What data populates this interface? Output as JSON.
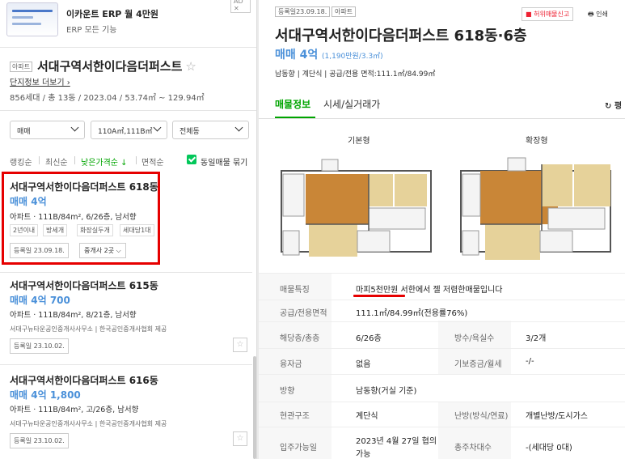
{
  "ad": {
    "title": "이카운트 ERP 월 4만원",
    "subtitle": "ERP 모든 기능",
    "badge": "AD ✕"
  },
  "complex": {
    "tag": "아파트",
    "name": "서대구역서한이다음더퍼스트",
    "link": "단지정보 더보기 ›",
    "info": "856세대 / 총 13동 / 2023.04 / 53.74㎡ ~ 129.94㎡"
  },
  "filters": [
    {
      "label": "매매"
    },
    {
      "label": "110A㎡,111B㎡"
    },
    {
      "label": "전체동"
    }
  ],
  "sort": {
    "items": [
      "랭킹순",
      "최신순",
      "낮은가격순 ↓",
      "면적순"
    ],
    "same_listing": "동일매물 묶기"
  },
  "listings": [
    {
      "title": "서대구역서한이다음더퍼스트 618동",
      "price": "매매 4억",
      "spec": "아파트 · 111B/84m², 6/26층, 남서향",
      "tags": [
        "2년이내",
        "방세개",
        "화장실두개",
        "세대당1대"
      ],
      "date": "등록일 23.09.18.",
      "agents": "중개사 2곳 ⌵"
    },
    {
      "title": "서대구역서한이다음더퍼스트 615동",
      "price": "매매 4억 700",
      "spec": "아파트 · 111B/84m², 8/21층, 남서향",
      "source": "서대구뉴타운공인중개사사무소 | 한국공인중개사협회 제공",
      "date": "등록일 23.10.02."
    },
    {
      "title": "서대구역서한이다음더퍼스트 616동",
      "price": "매매 4억 1,800",
      "spec": "아파트 · 111B/84m², 고/26층, 남서향",
      "source": "서대구뉴타운공인중개사사무소 | 한국공인중개사협회 제공",
      "date": "등록일 23.10.02."
    }
  ],
  "detail": {
    "date_tag": "등록일23.09.18.",
    "type_tag": "아파트",
    "report": "■ 허위매물신고",
    "print": "🖶 인쇄",
    "title": "서대구역서한이다음더퍼스트 618동·6층",
    "price": "매매 4억",
    "price_per": "(1,190만원/3.3㎡)",
    "meta": "남동향 | 계단식 | 공급/전용 면적:111.1㎡/84.99㎡",
    "tabs": [
      "매물정보",
      "시세/실거래가"
    ],
    "refresh": "↻ 평",
    "plan_labels": [
      "기본형",
      "확장형"
    ],
    "rows": [
      {
        "label": "매물특징",
        "value": "마피5천만원 서한에서 젤 저렴한매물입니다"
      },
      {
        "label": "공급/전용면적",
        "value": "111.1㎡/84.99㎡(전용률76%)"
      },
      {
        "label": "해당층/총층",
        "value": "6/26층",
        "label2": "방수/욕실수",
        "value2": "3/2개"
      },
      {
        "label": "융자금",
        "value": "없음",
        "label2": "기보증금/월세",
        "value2": "-/-"
      },
      {
        "label": "방향",
        "value": "남동향(거실 기준)"
      },
      {
        "label": "현관구조",
        "value": "계단식",
        "label2": "난방(방식/연료)",
        "value2": "개별난방/도시가스"
      },
      {
        "label": "입주가능일",
        "value": "2023년 4월 27일 협의",
        "value_cont": "가능",
        "label2": "총주차대수",
        "value2": "-(세대당 0대)"
      }
    ]
  }
}
